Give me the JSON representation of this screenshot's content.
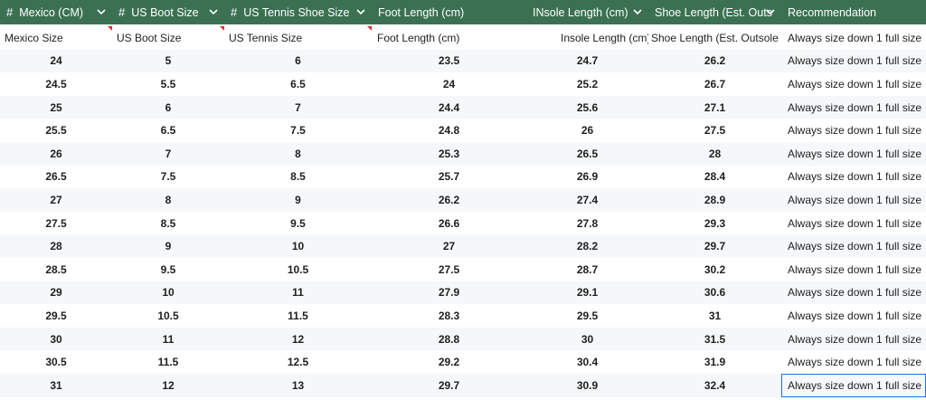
{
  "header": {
    "columns": [
      {
        "label": "Mexico (CM)",
        "hash": "#",
        "chevron": true
      },
      {
        "label": "US Boot Size",
        "hash": "#",
        "chevron": true
      },
      {
        "label": "US Tennis Shoe Size",
        "hash": "#",
        "chevron": true
      },
      {
        "label": "Foot Length (cm)",
        "hash": "",
        "chevron": false
      },
      {
        "label": "INsole Length (cm)",
        "hash": "",
        "chevron": true
      },
      {
        "label": "Shoe Length (Est. Outs",
        "hash": "",
        "chevron": true
      },
      {
        "label": "Recommendation",
        "hash": "",
        "chevron": false
      }
    ]
  },
  "subheader": [
    "Mexico Size",
    "US Boot Size",
    "US Tennis Size",
    "Foot Length (cm)",
    "Insole Length (cm)",
    "Shoe Length (Est. Outsole (",
    "Always size down 1 full size"
  ],
  "rows": [
    [
      "24",
      "5",
      "6",
      "23.5",
      "24.7",
      "26.2",
      "Always size down 1 full size"
    ],
    [
      "24.5",
      "5.5",
      "6.5",
      "24",
      "25.2",
      "26.7",
      "Always size down 1 full size"
    ],
    [
      "25",
      "6",
      "7",
      "24.4",
      "25.6",
      "27.1",
      "Always size down 1 full size"
    ],
    [
      "25.5",
      "6.5",
      "7.5",
      "24.8",
      "26",
      "27.5",
      "Always size down 1 full size"
    ],
    [
      "26",
      "7",
      "8",
      "25.3",
      "26.5",
      "28",
      "Always size down 1 full size"
    ],
    [
      "26.5",
      "7.5",
      "8.5",
      "25.7",
      "26.9",
      "28.4",
      "Always size down 1 full size"
    ],
    [
      "27",
      "8",
      "9",
      "26.2",
      "27.4",
      "28.9",
      "Always size down 1 full size"
    ],
    [
      "27.5",
      "8.5",
      "9.5",
      "26.6",
      "27.8",
      "29.3",
      "Always size down 1 full size"
    ],
    [
      "28",
      "9",
      "10",
      "27",
      "28.2",
      "29.7",
      "Always size down 1 full size"
    ],
    [
      "28.5",
      "9.5",
      "10.5",
      "27.5",
      "28.7",
      "30.2",
      "Always size down 1 full size"
    ],
    [
      "29",
      "10",
      "11",
      "27.9",
      "29.1",
      "30.6",
      "Always size down 1 full size"
    ],
    [
      "29.5",
      "10.5",
      "11.5",
      "28.3",
      "29.5",
      "31",
      "Always size down 1 full size"
    ],
    [
      "30",
      "11",
      "12",
      "28.8",
      "30",
      "31.5",
      "Always size down 1 full size"
    ],
    [
      "30.5",
      "11.5",
      "12.5",
      "29.2",
      "30.4",
      "31.9",
      "Always size down 1 full size"
    ],
    [
      "31",
      "12",
      "13",
      "29.7",
      "30.9",
      "32.4",
      "Always size down 1 full size"
    ]
  ],
  "colors": {
    "header_bg": "#3b7152",
    "selection": "#1a73e8",
    "note_flag": "#e03131"
  }
}
